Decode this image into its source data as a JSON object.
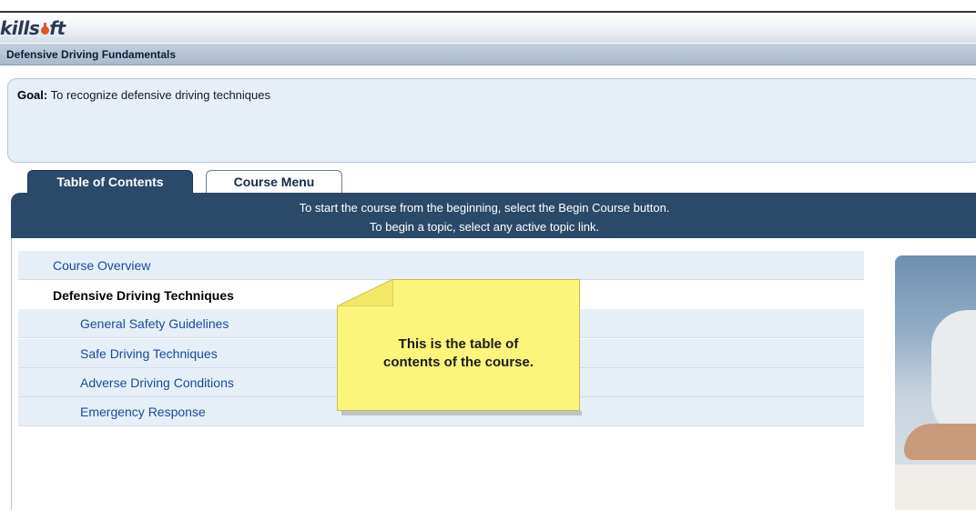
{
  "brand": {
    "logo_left": "kills",
    "logo_right": "ft"
  },
  "course": {
    "title": "Defensive Driving Fundamentals"
  },
  "goal": {
    "label": "Goal:",
    "text": " To recognize defensive driving techniques"
  },
  "tabs": [
    {
      "label": "Table of Contents",
      "active": true
    },
    {
      "label": "Course Menu",
      "active": false
    }
  ],
  "banner": {
    "line1": "To start the course from the beginning, select the Begin Course button.",
    "line2": "To begin a topic, select any active topic link."
  },
  "toc": [
    {
      "label": "Course Overview",
      "type": "link"
    },
    {
      "label": "Defensive Driving Techniques",
      "type": "section"
    },
    {
      "label": "General Safety Guidelines",
      "type": "link"
    },
    {
      "label": "Safe Driving Techniques",
      "type": "link"
    },
    {
      "label": "Adverse Driving Conditions",
      "type": "link"
    },
    {
      "label": "Emergency Response",
      "type": "link"
    }
  ],
  "callout": {
    "line1": "This is the table of",
    "line2": "contents of the course."
  },
  "colors": {
    "accent": "#2b4a6a",
    "link": "#1a4a9c",
    "callout": "#fbf57c"
  }
}
